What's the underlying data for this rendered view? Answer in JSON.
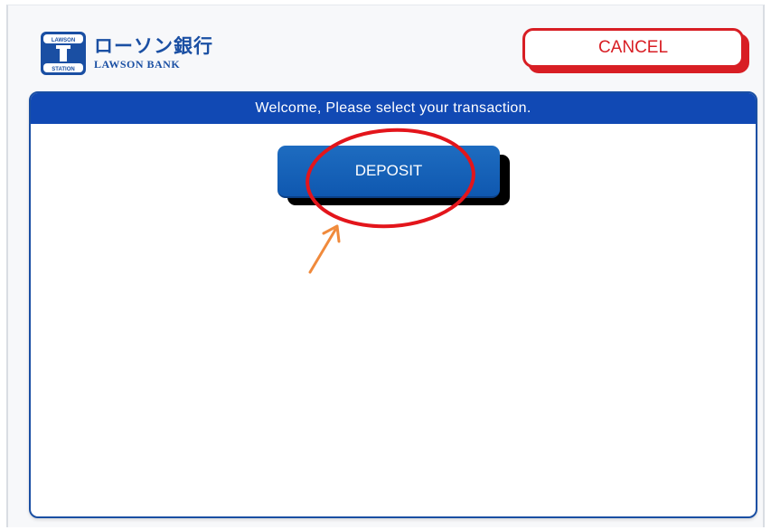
{
  "brand": {
    "name_jp": "ローソン銀行",
    "name_en": "LAWSON BANK",
    "badge_top": "LAWSON",
    "badge_bottom": "STATION",
    "color": "#1a4fa3"
  },
  "header": {
    "cancel_label": "CANCEL",
    "cancel_color": "#d81e24"
  },
  "main": {
    "instruction": "Welcome, Please select your transaction.",
    "header_color": "#1149b4",
    "buttons": [
      {
        "label": "DEPOSIT",
        "color": "#1565c0"
      }
    ]
  },
  "annotation": {
    "highlight_color": "#e3151b",
    "arrow_color": "#f08a3c"
  }
}
